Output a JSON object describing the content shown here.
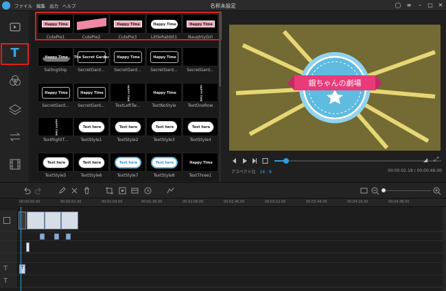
{
  "titlebar": {
    "menu": [
      "ファイル",
      "編集",
      "出力",
      "ヘルプ"
    ],
    "title": "名称未設定",
    "controls": [
      "user-icon",
      "menu-icon",
      "minimize-icon",
      "maximize-icon",
      "close-icon"
    ]
  },
  "sidebar": {
    "tabs": [
      {
        "name": "media-tab",
        "icon": "video-icon",
        "active": false
      },
      {
        "name": "text-tab",
        "icon": "text-t-icon",
        "label": "T",
        "active": true
      },
      {
        "name": "filters-tab",
        "icon": "filter-circles-icon",
        "active": false
      },
      {
        "name": "overlays-tab",
        "icon": "layers-icon",
        "active": false
      },
      {
        "name": "transitions-tab",
        "icon": "transition-arrows-icon",
        "active": false
      },
      {
        "name": "elements-tab",
        "icon": "film-icon",
        "active": false
      }
    ]
  },
  "text_panel": {
    "rows": [
      [
        {
          "label": "CutePie1",
          "thumb": "Happy Time"
        },
        {
          "label": "CutePie2",
          "thumb": ""
        },
        {
          "label": "CutePie3",
          "thumb": "Happy Time"
        },
        {
          "label": "LittleRabbit1",
          "thumb": "Happy Time"
        },
        {
          "label": "NaughtyGirl",
          "thumb": "Happy Time"
        }
      ],
      [
        {
          "label": "SailingShip",
          "thumb": "Happy Time"
        },
        {
          "label": "SecretGard...",
          "thumb": "The Secret Garden"
        },
        {
          "label": "SecretGard...",
          "thumb": "Happy Time"
        },
        {
          "label": "SecretGard...",
          "thumb": "Happy Time"
        },
        {
          "label": "SecretGard...",
          "thumb": ""
        }
      ],
      [
        {
          "label": "SecretGard...",
          "thumb": "Happy Time"
        },
        {
          "label": "SecretGard...",
          "thumb": "Happy Time"
        },
        {
          "label": "TextLeftTw...",
          "thumb": "HAPPY TIME"
        },
        {
          "label": "TextNoStyle",
          "thumb": "Happy Time"
        },
        {
          "label": "TextOneRow",
          "thumb": "HAPPY TIME"
        }
      ],
      [
        {
          "label": "TextRightT...",
          "thumb": "HAPPY TIME"
        },
        {
          "label": "TextStyle1",
          "thumb": "Text here"
        },
        {
          "label": "TextStyle2",
          "thumb": "Text here"
        },
        {
          "label": "TextStyle3",
          "thumb": "Text here"
        },
        {
          "label": "TextStyle4",
          "thumb": "Text here"
        }
      ],
      [
        {
          "label": "TextStyle5",
          "thumb": "Text here"
        },
        {
          "label": "TextStyle6",
          "thumb": "Text here"
        },
        {
          "label": "TextStyle7",
          "thumb": "Text here"
        },
        {
          "label": "TextStyle8",
          "thumb": "Text here"
        },
        {
          "label": "TextThree1",
          "thumb": "Happy Time"
        }
      ]
    ]
  },
  "preview": {
    "caption": "銀ちゃんの劇場",
    "aspect_label": "アスペクト比",
    "aspect_value": "16 : 9",
    "time": "00:00:02.18 / 00:00:46.00",
    "progress": 0.07
  },
  "timeline": {
    "ruler": [
      "00:00:00.00",
      "00:00:52.00",
      "00:01:04.00",
      "00:01:36.00",
      "00:02:08.00",
      "00:02:40.00",
      "00:03:12.00",
      "00:03:44.00",
      "00:04:16.00",
      "00:04:48.00"
    ],
    "text_clip_label": "T"
  },
  "colors": {
    "highlight": "#e0201c",
    "accent": "#2f9fe0",
    "preview_bg": "#736a34",
    "badge_blue": "#5fbbe0",
    "ribbon_pink": "#e93a7a"
  }
}
